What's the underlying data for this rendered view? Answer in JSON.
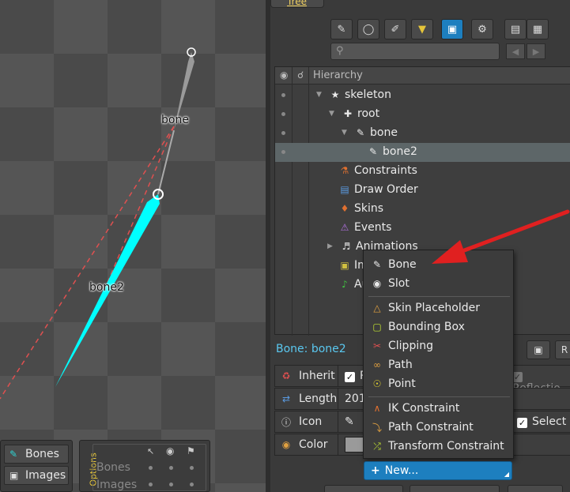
{
  "viewport": {
    "bone_labels": {
      "bone": "bone",
      "bone2": "bone2"
    },
    "panel_buttons": {
      "bones": "Bones",
      "images": "Images"
    },
    "options_panel": {
      "vertical_label": "Options",
      "rows": [
        "Bones",
        "Images"
      ]
    }
  },
  "tree": {
    "tab_label": "Tree",
    "header": {
      "hierarchy": "Hierarchy"
    },
    "rows": [
      {
        "label": "skeleton",
        "icon": "skeleton-icon"
      },
      {
        "label": "root",
        "icon": "root-icon"
      },
      {
        "label": "bone",
        "icon": "bone-icon"
      },
      {
        "label": "bone2",
        "icon": "bone-icon",
        "selected": true
      },
      {
        "label": "Constraints",
        "icon": "constraints-icon"
      },
      {
        "label": "Draw Order",
        "icon": "draw-order-icon"
      },
      {
        "label": "Skins",
        "icon": "skins-icon"
      },
      {
        "label": "Events",
        "icon": "events-icon"
      },
      {
        "label": "Animations",
        "icon": "animations-icon"
      },
      {
        "label": "Im",
        "icon": "images-icon"
      },
      {
        "label": "Au",
        "icon": "audio-icon"
      }
    ]
  },
  "properties": {
    "title": "Bone: bone2",
    "inherit_label": "Inherit",
    "inherit_value": "R",
    "reflection_label": "Reflectio",
    "length_label": "Length",
    "length_value": "201",
    "icon_label": "Icon",
    "select_label": "Select",
    "color_label": "Color",
    "r_button": "R"
  },
  "context_menu": {
    "items": {
      "bone": "Bone",
      "slot": "Slot",
      "skin_placeholder": "Skin Placeholder",
      "bounding_box": "Bounding Box",
      "clipping": "Clipping",
      "path": "Path",
      "point": "Point",
      "ik_constraint": "IK Constraint",
      "path_constraint": "Path Constraint",
      "transform_constraint": "Transform Constraint"
    }
  },
  "new_button": {
    "label": "New..."
  },
  "colors": {
    "selected_bone": "#00ffff",
    "accent_blue": "#1d7fbf",
    "annotation_arrow": "#e02020",
    "title_blue": "#5ac8f0"
  }
}
